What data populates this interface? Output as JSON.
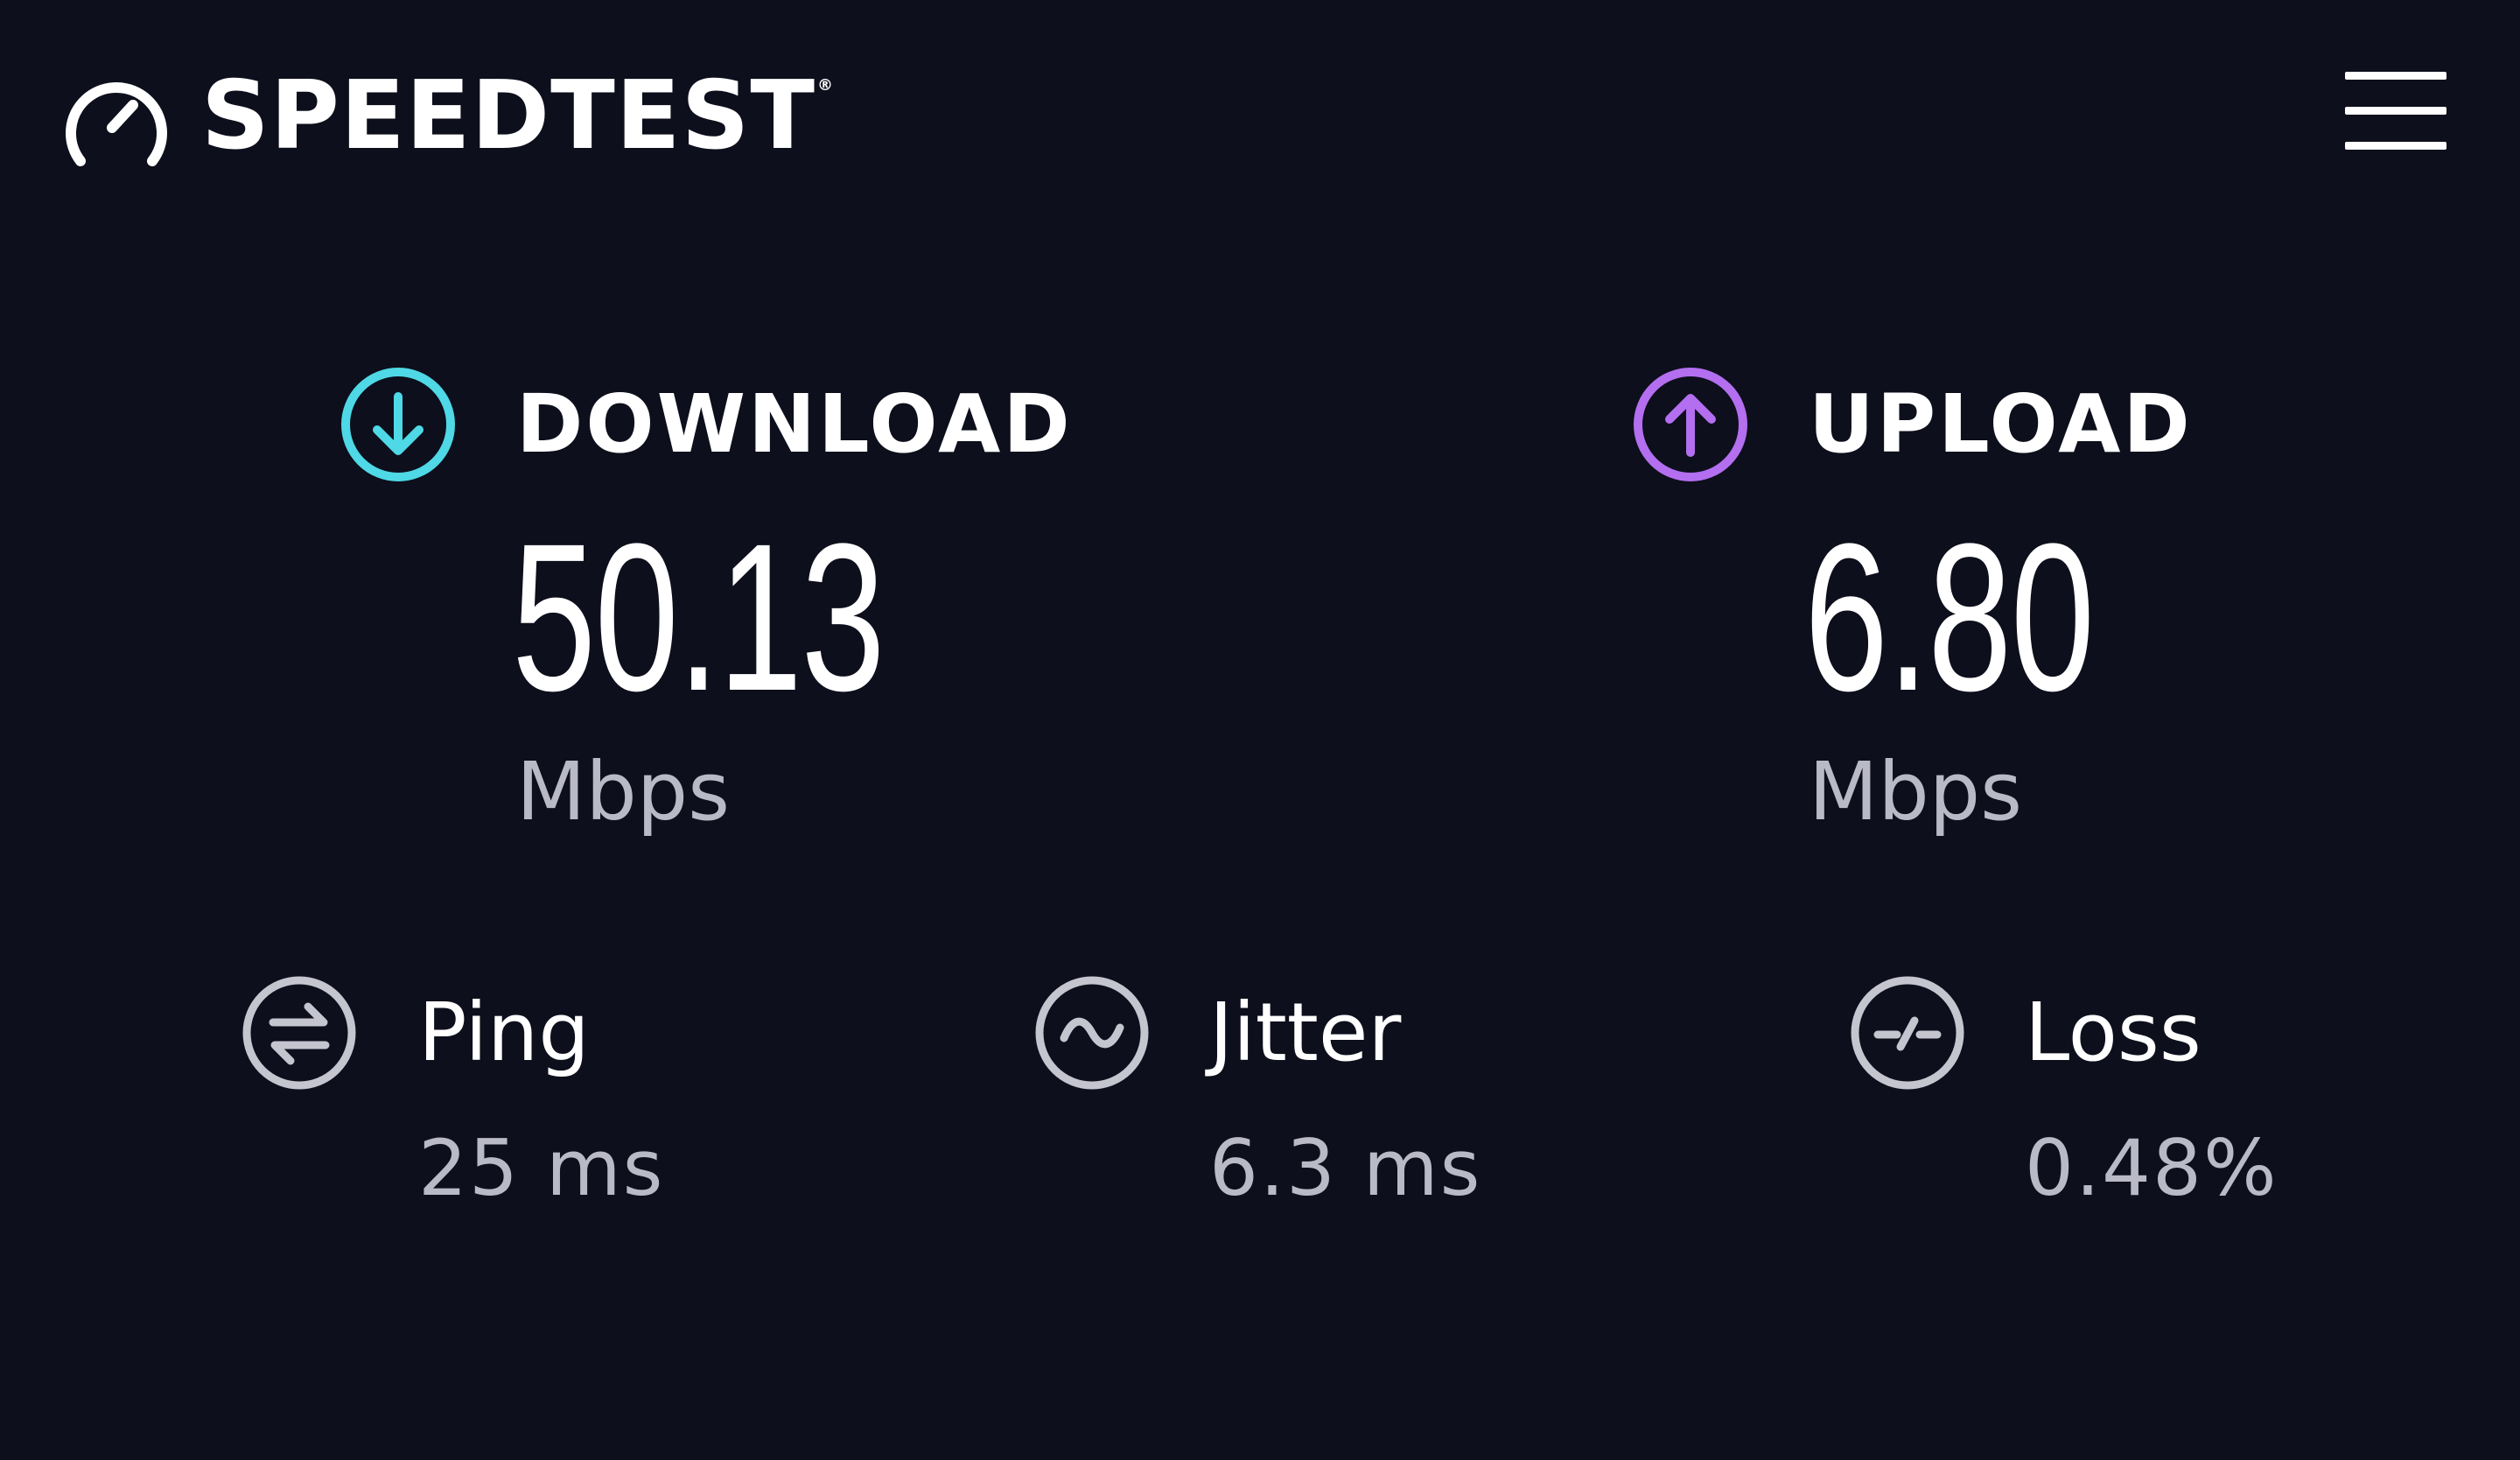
{
  "header": {
    "brand_name": "SPEEDTEST",
    "trademark": "®",
    "logo_icon": "speedometer-icon",
    "menu_icon": "hamburger-menu-icon"
  },
  "results": {
    "download": {
      "label": "DOWNLOAD",
      "value": "50.13",
      "unit": "Mbps",
      "icon": "download-arrow-icon",
      "color": "#4fd8e6"
    },
    "upload": {
      "label": "UPLOAD",
      "value": "6.80",
      "unit": "Mbps",
      "icon": "upload-arrow-icon",
      "color": "#b46ef0"
    }
  },
  "metrics": {
    "ping": {
      "label": "Ping",
      "value": "25 ms",
      "icon": "ping-icon"
    },
    "jitter": {
      "label": "Jitter",
      "value": "6.3 ms",
      "icon": "jitter-wave-icon"
    },
    "loss": {
      "label": "Loss",
      "value": "0.48%",
      "icon": "packet-loss-icon"
    }
  },
  "colors": {
    "background": "#0d0f1c",
    "primary_text": "#ffffff",
    "secondary_text": "#b9bac6",
    "metric_icon": "#c4c5cf"
  }
}
